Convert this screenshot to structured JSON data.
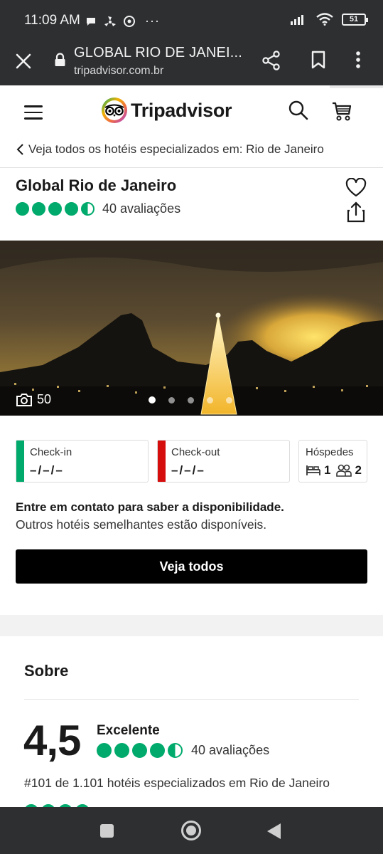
{
  "status_bar": {
    "time": "11:09 AM",
    "overflow": "···",
    "battery": "51"
  },
  "browser": {
    "title": "GLOBAL RIO DE JANEI...",
    "url": "tripadvisor.com.br",
    "load_progress_percent": 86
  },
  "site": {
    "logo_text": "Tripadvisor",
    "brand_color": "#00aa6c"
  },
  "breadcrumb": {
    "text": "Veja todos os hotéis especializados em: Rio de Janeiro"
  },
  "hotel": {
    "name": "Global Rio de Janeiro",
    "rating_bubbles": 4.5,
    "reviews": "40 avaliações"
  },
  "gallery": {
    "photo_count": "50",
    "slides": 5,
    "active_slide": 1
  },
  "booking": {
    "checkin_label": "Check-in",
    "checkin_value": "–/–/–",
    "checkin_color": "#00aa6c",
    "checkout_label": "Check-out",
    "checkout_value": "–/–/–",
    "checkout_color": "#d50d0d",
    "guests_label": "Hóspedes",
    "rooms": "1",
    "guests": "2"
  },
  "availability": {
    "message_bold": "Entre em contato para saber a disponibilidade.",
    "message": "Outros hotéis semelhantes estão disponíveis.",
    "button": "Veja todos"
  },
  "about": {
    "title": "Sobre",
    "score": "4,5",
    "score_label": "Excelente",
    "reviews": "40 avaliações",
    "ranking": "#101 de 1.101 hotéis especializados em Rio de Janeiro"
  }
}
